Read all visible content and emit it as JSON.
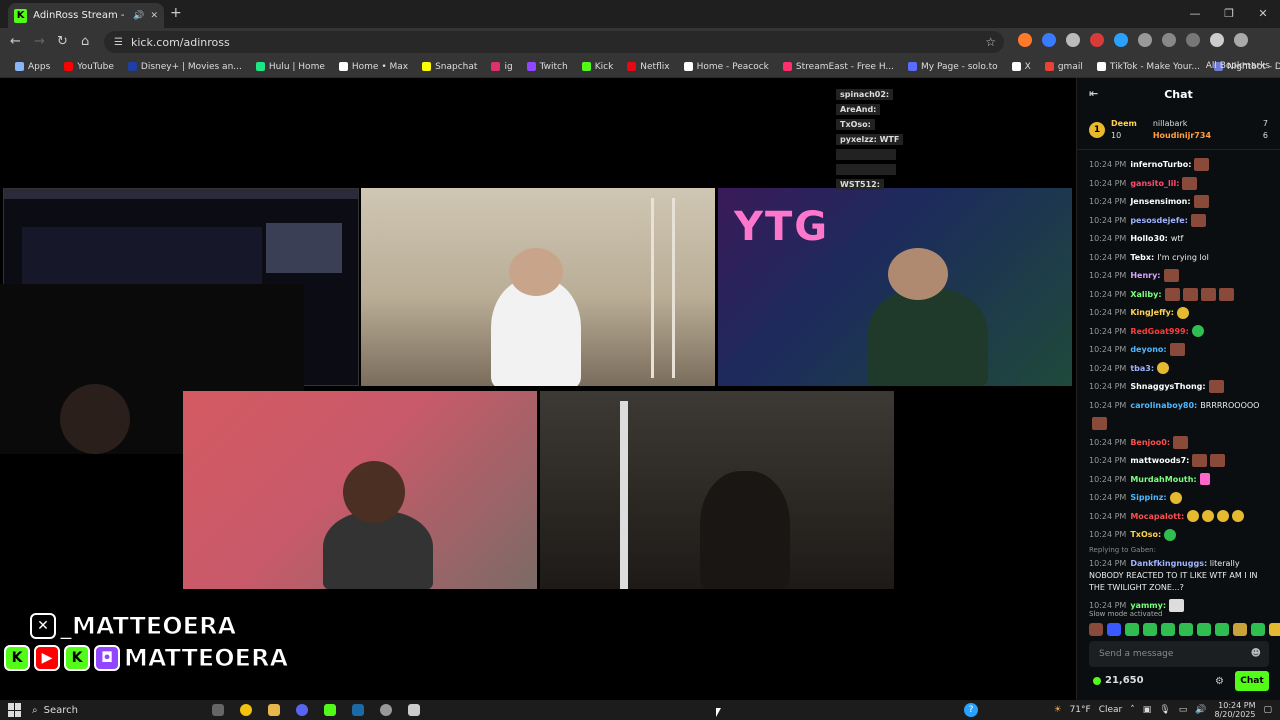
{
  "browser": {
    "tab_title": "AdinRoss Stream - Watch L",
    "url": "kick.com/adinross",
    "bookmarks": [
      {
        "label": "Apps",
        "color": "#8ab4f8"
      },
      {
        "label": "YouTube",
        "color": "#ff0000"
      },
      {
        "label": "Disney+ | Movies an...",
        "color": "#1d3fa6"
      },
      {
        "label": "Hulu | Home",
        "color": "#1ce783"
      },
      {
        "label": "Home • Max",
        "color": "#ffffff"
      },
      {
        "label": "Snapchat",
        "color": "#fffc00"
      },
      {
        "label": "ig",
        "color": "#e1306c"
      },
      {
        "label": "Twitch",
        "color": "#9146ff"
      },
      {
        "label": "Kick",
        "color": "#53fc18"
      },
      {
        "label": "Netflix",
        "color": "#e50914"
      },
      {
        "label": "Home - Peacock",
        "color": "#ffffff"
      },
      {
        "label": "StreamEast - Free H...",
        "color": "#ff2f6e"
      },
      {
        "label": "My Page - solo.to",
        "color": "#5a6cff"
      },
      {
        "label": "X",
        "color": "#ffffff"
      },
      {
        "label": "gmail",
        "color": "#ea4335"
      },
      {
        "label": "TikTok - Make Your...",
        "color": "#ffffff"
      },
      {
        "label": "Nightbot - Dashboa...",
        "color": "#6f7bd8"
      }
    ],
    "all_bookmarks": "All Bookmarks"
  },
  "stream": {
    "neon_sign": "YTG",
    "chat_overlay": [
      "spinach02:",
      "AreAnd:",
      "TxOso:",
      "pyxelzz: WTF",
      "",
      "",
      "WST512:"
    ],
    "handle_top": "_MATTEOERA",
    "handle_bottom": "MATTEOERA"
  },
  "chat": {
    "title": "Chat",
    "leaderboard": {
      "rank": "1",
      "first_name": "Deem",
      "first_count": "10",
      "second_name": "nillabark",
      "second_count": "7",
      "third_name": "Houdinijr734",
      "third_count": "6"
    },
    "messages": [
      {
        "time": "10:24 PM",
        "user": "infernoTurbo:",
        "color": "#ffffff",
        "text": "",
        "emotes": [
          "e"
        ]
      },
      {
        "time": "10:24 PM",
        "user": "gansito_lil:",
        "color": "#ff4d6a",
        "text": "",
        "emotes": [
          "e"
        ]
      },
      {
        "time": "10:24 PM",
        "user": "Jensensimon:",
        "color": "#ffffff",
        "text": "",
        "emotes": [
          "e"
        ]
      },
      {
        "time": "10:24 PM",
        "user": "pesosdejefe:",
        "color": "#9fb4ff",
        "text": "",
        "emotes": [
          "e"
        ]
      },
      {
        "time": "10:24 PM",
        "user": "Hollo30:",
        "color": "#ffffff",
        "text": "wtf",
        "emotes": []
      },
      {
        "time": "10:24 PM",
        "user": "Tebx:",
        "color": "#ffffff",
        "text": "I'm crying lol",
        "emotes": []
      },
      {
        "time": "10:24 PM",
        "user": "Henry:",
        "color": "#d6a6ff",
        "text": "",
        "emotes": [
          "e"
        ]
      },
      {
        "time": "10:24 PM",
        "user": "Xaliby:",
        "color": "#7cff7c",
        "text": "",
        "emotes": [
          "e",
          "e",
          "e",
          "e"
        ]
      },
      {
        "time": "10:24 PM",
        "user": "KingJeffy:",
        "color": "#ffd34d",
        "text": "",
        "emotes": [
          "y"
        ]
      },
      {
        "time": "10:24 PM",
        "user": "RedGoat999:",
        "color": "#ff3b3b",
        "text": "",
        "emotes": [
          "g"
        ]
      },
      {
        "time": "10:24 PM",
        "user": "deyono:",
        "color": "#4db8ff",
        "text": "",
        "emotes": [
          "e"
        ]
      },
      {
        "time": "10:24 PM",
        "user": "tba3:",
        "color": "#9fb4ff",
        "text": "",
        "emotes": [
          "y"
        ]
      },
      {
        "time": "10:24 PM",
        "user": "ShnaggysThong:",
        "color": "#ffffff",
        "text": "",
        "emotes": [
          "e"
        ]
      },
      {
        "time": "10:24 PM",
        "user": "carolinaboy80:",
        "color": "#4db8ff",
        "text": "BRRRROOOOO",
        "emotes": []
      },
      {
        "time": "",
        "user": "",
        "color": "#ffffff",
        "text": "",
        "emotes": [
          "e"
        ]
      },
      {
        "time": "10:24 PM",
        "user": "Benjoo0:",
        "color": "#ff4d4d",
        "text": "",
        "emotes": [
          "e"
        ]
      },
      {
        "time": "10:24 PM",
        "user": "mattwoods7:",
        "color": "#ffffff",
        "text": "",
        "emotes": [
          "e",
          "e"
        ]
      },
      {
        "time": "10:24 PM",
        "user": "MurdahMouth:",
        "color": "#7cff7c",
        "text": "",
        "emotes": [
          "p"
        ]
      },
      {
        "time": "10:24 PM",
        "user": "Sippinz:",
        "color": "#4db8ff",
        "text": "",
        "emotes": [
          "y"
        ]
      },
      {
        "time": "10:24 PM",
        "user": "Mocapalott:",
        "color": "#ff4d4d",
        "text": "",
        "emotes": [
          "y",
          "y",
          "y",
          "y"
        ]
      },
      {
        "time": "10:24 PM",
        "user": "TxOso:",
        "color": "#ffd34d",
        "text": "",
        "emotes": [
          "g"
        ]
      }
    ],
    "reply_to": "Replying to Gaben:",
    "reply_msg": {
      "time": "10:24 PM",
      "user": "Dankfkingnuggs:",
      "text": "literally NOBODY REACTED TO IT LIKE WTF AM I IN THE TWILIGHT ZONE...?"
    },
    "last_msg": {
      "time": "10:24 PM",
      "user": "yammy:"
    },
    "slow_mode": "Slow mode activated",
    "input_placeholder": "Send a message",
    "points": "21,650",
    "chat_button": "Chat"
  },
  "taskbar": {
    "search": "Search",
    "weather": "71°F",
    "weather_desc": "Clear",
    "time": "10:24 PM",
    "date": "8/20/2025"
  }
}
